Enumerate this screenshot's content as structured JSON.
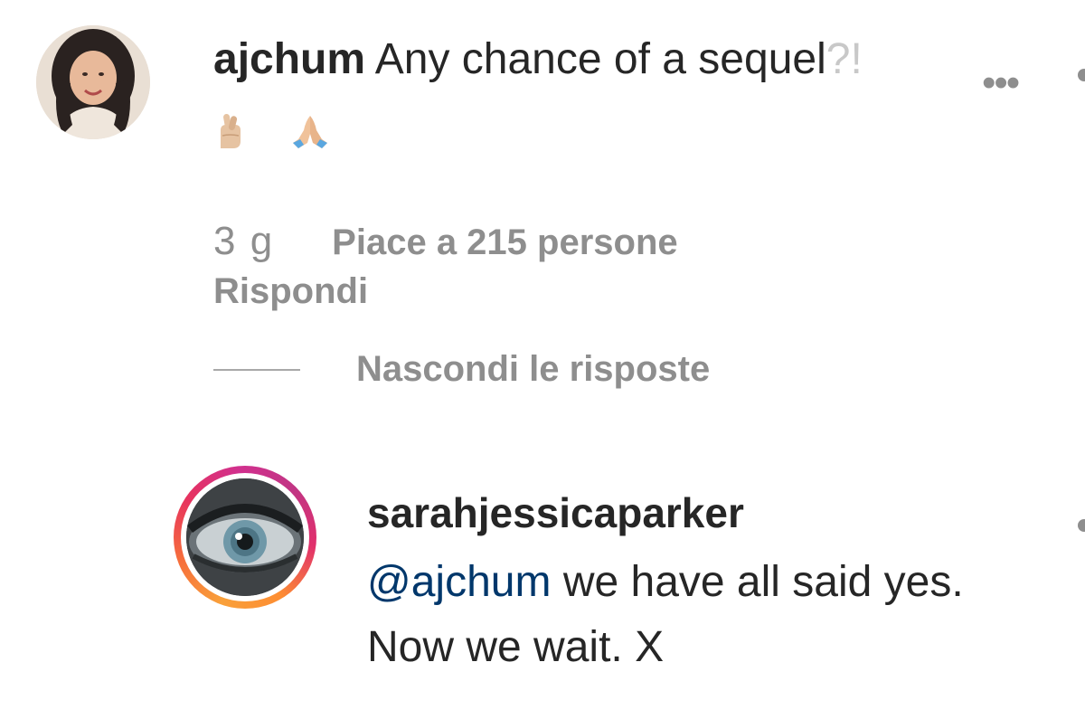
{
  "comment": {
    "username": "ajchum",
    "text": "Any chance of a sequel",
    "text_faded_tail": "?!",
    "emojis": [
      "crossed-fingers-emoji",
      "folded-hands-emoji"
    ],
    "time": "3 g",
    "likes": "Piace a 215 persone",
    "reply_label": "Rispondi"
  },
  "replies_toggle": {
    "label": "Nascondi le risposte"
  },
  "reply": {
    "username": "sarahjessicaparker",
    "mention": "@ajchum",
    "text": "we have all said yes. Now we wait. X"
  },
  "icons": {
    "more": "more-options-icon",
    "story_ring": "story-ring"
  },
  "colors": {
    "text": "#262626",
    "muted": "#8e8e8e",
    "mention": "#00376b",
    "ring_start": "#f9a03a",
    "ring_end": "#c13584"
  }
}
